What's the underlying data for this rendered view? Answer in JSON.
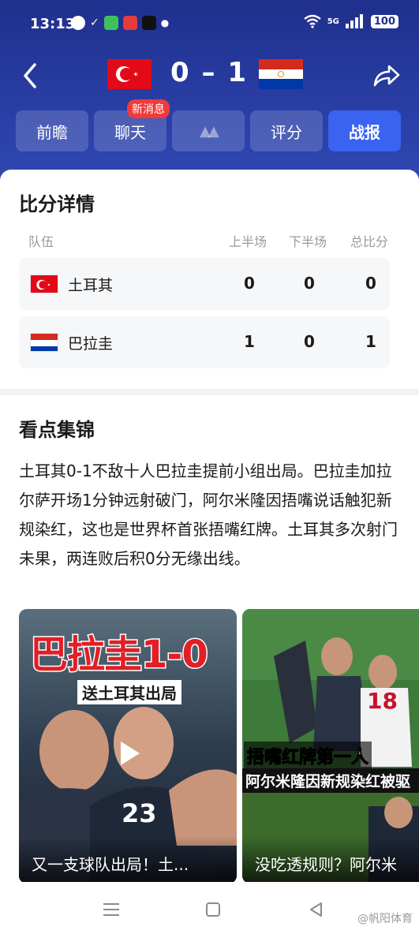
{
  "status_bar": {
    "time": "13:13",
    "battery": "100",
    "network": "5G"
  },
  "match": {
    "score": "0 – 1",
    "home_team": "土耳其",
    "away_team": "巴拉圭"
  },
  "tabs": [
    {
      "label": "前瞻",
      "active": false
    },
    {
      "label": "聊天",
      "active": false,
      "badge": "新消息"
    },
    {
      "label": "▲▲",
      "active": false
    },
    {
      "label": "评分",
      "active": false
    },
    {
      "label": "战报",
      "active": true
    }
  ],
  "score_detail": {
    "title": "比分详情",
    "headers": {
      "team": "队伍",
      "first_half": "上半场",
      "second_half": "下半场",
      "total": "总比分"
    },
    "rows": [
      {
        "team": "土耳其",
        "first_half": "0",
        "second_half": "0",
        "total": "0"
      },
      {
        "team": "巴拉圭",
        "first_half": "1",
        "second_half": "0",
        "total": "1"
      }
    ]
  },
  "highlights": {
    "title": "看点集锦",
    "summary": "土耳其0-1不敌十人巴拉圭提前小组出局。巴拉圭加拉尔萨开场1分钟远射破门，阿尔米隆因捂嘴说话触犯新规染红，这也是世界杯首张捂嘴红牌。土耳其多次射门未果，两连败后积0分无缘出线。",
    "videos": [
      {
        "overlay_title": "巴拉圭1-0",
        "overlay_sub": "送土耳其出局",
        "caption": "又一支球队出局！土...",
        "shirt_number": "23"
      },
      {
        "overlay_title": "捂嘴红牌第一人",
        "overlay_sub": "阿尔米隆因新规染红被驱",
        "caption": "没吃透规则？阿尔米",
        "shirt_number": "18"
      }
    ]
  },
  "watermark": "@帆阳体育",
  "colors": {
    "header_dark": "#1f2f8c",
    "tab_active": "#3a63f0",
    "badge": "#ef3b3b"
  }
}
